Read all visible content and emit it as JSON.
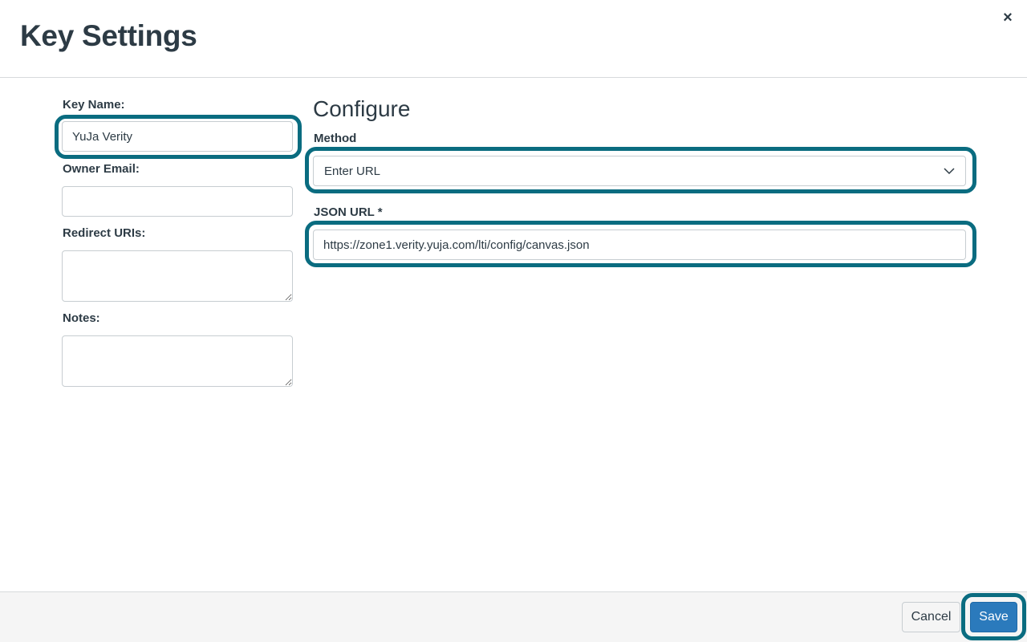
{
  "dialog": {
    "title": "Key Settings",
    "close_label": "×"
  },
  "form": {
    "key_name": {
      "label": "Key Name:",
      "value": "YuJa Verity"
    },
    "owner_email": {
      "label": "Owner Email:",
      "value": ""
    },
    "redirect_uris": {
      "label": "Redirect URIs:",
      "value": ""
    },
    "notes": {
      "label": "Notes:",
      "value": ""
    }
  },
  "configure": {
    "heading": "Configure",
    "method": {
      "label": "Method",
      "selected": "Enter URL"
    },
    "json_url": {
      "label": "JSON URL *",
      "value": "https://zone1.verity.yuja.com/lti/config/canvas.json"
    }
  },
  "footer": {
    "cancel_label": "Cancel",
    "save_label": "Save"
  },
  "colors": {
    "highlight": "#0a6c80",
    "primary_button": "#2b7abc",
    "text": "#2d3b45"
  }
}
